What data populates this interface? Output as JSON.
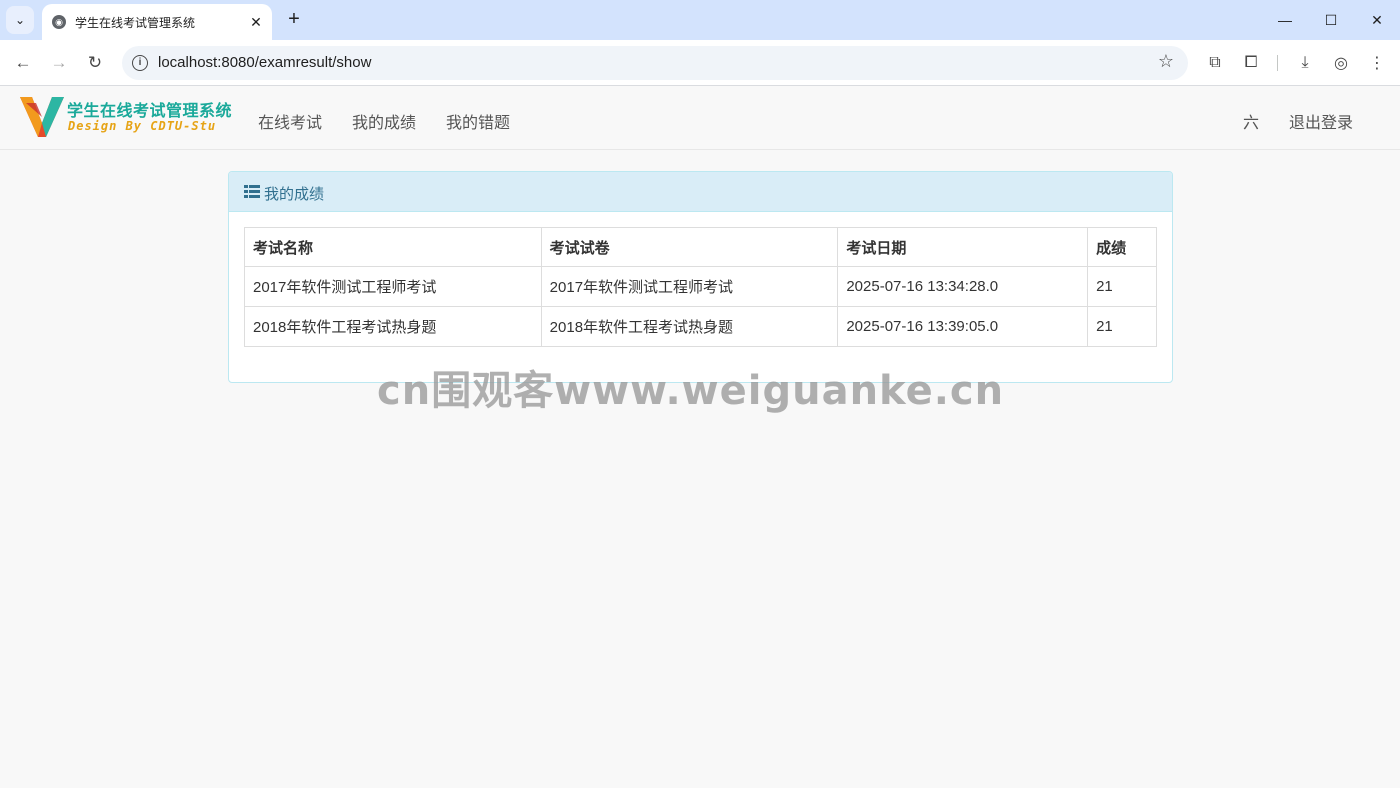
{
  "browser": {
    "tab_title": "学生在线考试管理系统",
    "url": "localhost:8080/examresult/show",
    "new_tab_label": "+",
    "close_tab_label": "✕"
  },
  "site": {
    "logo_title": "学生在线考试管理系统",
    "logo_subtitle": "Design By CDTU-Stu",
    "nav": [
      {
        "label": "在线考试"
      },
      {
        "label": "我的成绩"
      },
      {
        "label": "我的错题"
      }
    ],
    "user_name": "六",
    "logout_label": "退出登录"
  },
  "panel": {
    "title": "我的成绩"
  },
  "table": {
    "headers": [
      "考试名称",
      "考试试卷",
      "考试日期",
      "成绩"
    ],
    "rows": [
      [
        "2017年软件测试工程师考试",
        "2017年软件测试工程师考试",
        "2025-07-16 13:34:28.0",
        "21"
      ],
      [
        "2018年软件工程考试热身题",
        "2018年软件工程考试热身题",
        "2025-07-16 13:39:05.0",
        "21"
      ]
    ]
  },
  "watermark": "cn围观客www.weiguanke.cn",
  "colors": {
    "tabstrip": "#d3e3fd",
    "panel_heading": "#d9edf7",
    "panel_title": "#31708f",
    "logo_teal": "#1aa99a",
    "logo_orange": "#e6a315"
  }
}
